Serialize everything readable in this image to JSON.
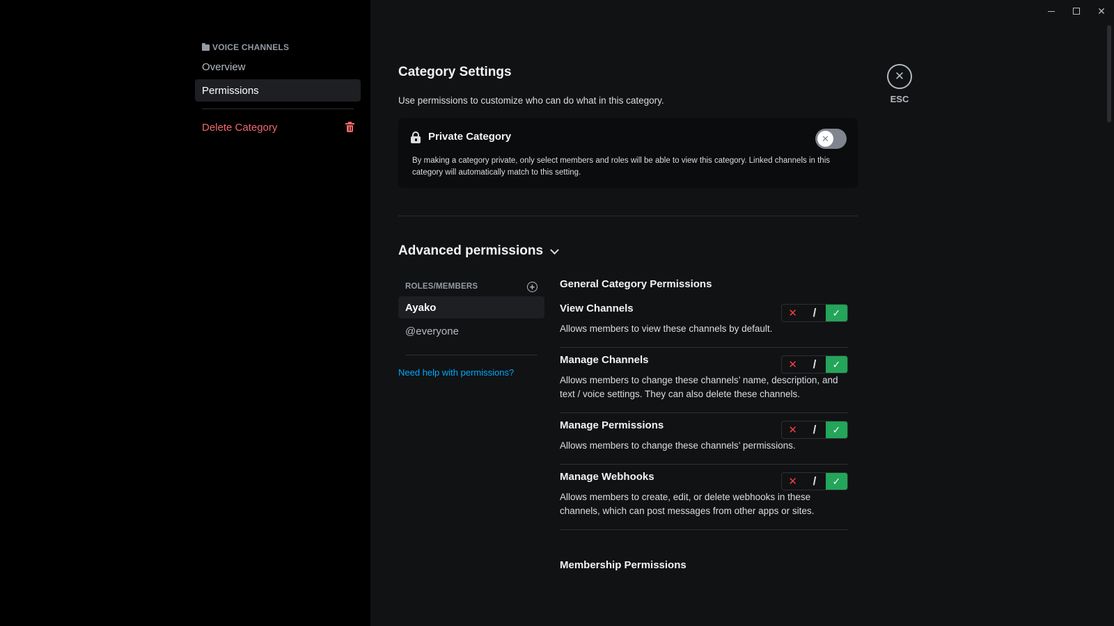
{
  "sidebar": {
    "section_header": "VOICE CHANNELS",
    "items": [
      {
        "label": "Overview"
      },
      {
        "label": "Permissions"
      }
    ],
    "delete_label": "Delete Category"
  },
  "window": {
    "minimize": "minimize",
    "maximize": "maximize",
    "close": "✕"
  },
  "main": {
    "title": "Category Settings",
    "subtitle": "Use permissions to customize who can do what in this category.",
    "private": {
      "title": "Private Category",
      "description": "By making a category private, only select members and roles will be able to view this category. Linked channels in this category will automatically match to this setting.",
      "enabled": false
    },
    "advanced": {
      "title": "Advanced permissions",
      "roles_header": "ROLES/MEMBERS",
      "roles": [
        {
          "label": "Ayako",
          "selected": true
        },
        {
          "label": "@everyone",
          "selected": false
        }
      ],
      "help_link": "Need help with permissions?",
      "section_title": "General Category Permissions",
      "permissions": [
        {
          "name": "View Channels",
          "description": "Allows members to view these channels by default.",
          "state": "allow"
        },
        {
          "name": "Manage Channels",
          "description": "Allows members to change these channels’ name, description, and text / voice settings. They can also delete these channels.",
          "state": "allow"
        },
        {
          "name": "Manage Permissions",
          "description": "Allows members to change these channels’ permissions.",
          "state": "allow"
        },
        {
          "name": "Manage Webhooks",
          "description": "Allows members to create, edit, or delete webhooks in these channels, which can post messages from other apps or sites.",
          "state": "allow"
        }
      ],
      "next_section_title": "Membership Permissions"
    }
  },
  "toggle_glyphs": {
    "deny": "✕",
    "neutral": "/",
    "allow": "✓"
  },
  "esc": {
    "label": "ESC",
    "icon": "✕"
  },
  "colors": {
    "allow": "#23a55a",
    "deny": "#f23f43",
    "link": "#00a8fc",
    "danger": "#f2686c"
  }
}
